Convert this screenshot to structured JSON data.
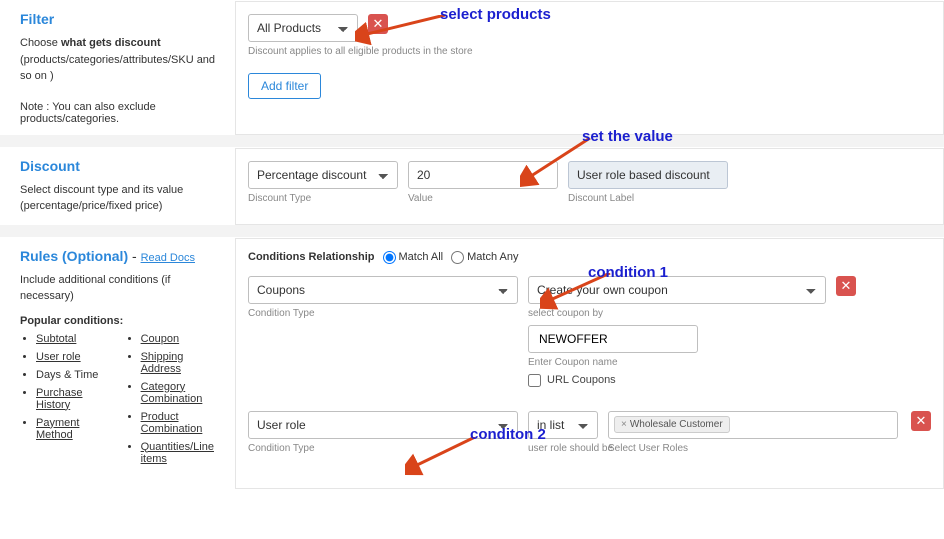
{
  "annotations": {
    "select_products": "select products",
    "set_the_value": "set the value",
    "condition1": "condition 1",
    "condition2": "conditon 2"
  },
  "filter": {
    "title": "Filter",
    "choose_prefix": "Choose ",
    "choose_bold": "what gets discount",
    "choose_suffix": " (products/categories/attributes/SKU and so on )",
    "note": "Note : You can also exclude products/categories.",
    "product_select": "All Products",
    "applies_note": "Discount applies to all eligible products in the store",
    "add_filter": "Add filter"
  },
  "discount": {
    "title": "Discount",
    "help": "Select discount type and its value (percentage/price/fixed price)",
    "type_value": "Percentage discount",
    "type_label": "Discount Type",
    "value": "20",
    "value_label": "Value",
    "label_value": "User role based discount",
    "label_label": "Discount Label"
  },
  "rules": {
    "title": "Rules (Optional)",
    "dash": " - ",
    "read_docs": "Read Docs",
    "help": "Include additional conditions (if necessary)",
    "popular_title": "Popular conditions:",
    "popular_left": [
      "Subtotal",
      "User role",
      "Days & Time",
      "Purchase History",
      "Payment Method"
    ],
    "popular_right": [
      "Coupon",
      "Shipping Address",
      "Category Combination",
      "Product Combination",
      "Quantities/Line items"
    ],
    "cond_rel_label": "Conditions Relationship",
    "match_all": "Match All",
    "match_any": "Match Any",
    "cond1": {
      "type": "Coupons",
      "type_label": "Condition Type",
      "mode": "Create your own coupon",
      "mode_label": "select coupon by",
      "coupon_name": "NEWOFFER",
      "coupon_hint": "Enter Coupon name",
      "url_coupons": "URL Coupons"
    },
    "cond2": {
      "type": "User role",
      "type_label": "Condition Type",
      "op": "in list",
      "op_label": "user role should be",
      "tag": "Wholesale Customer",
      "placeholder": "Select User Roles"
    }
  }
}
